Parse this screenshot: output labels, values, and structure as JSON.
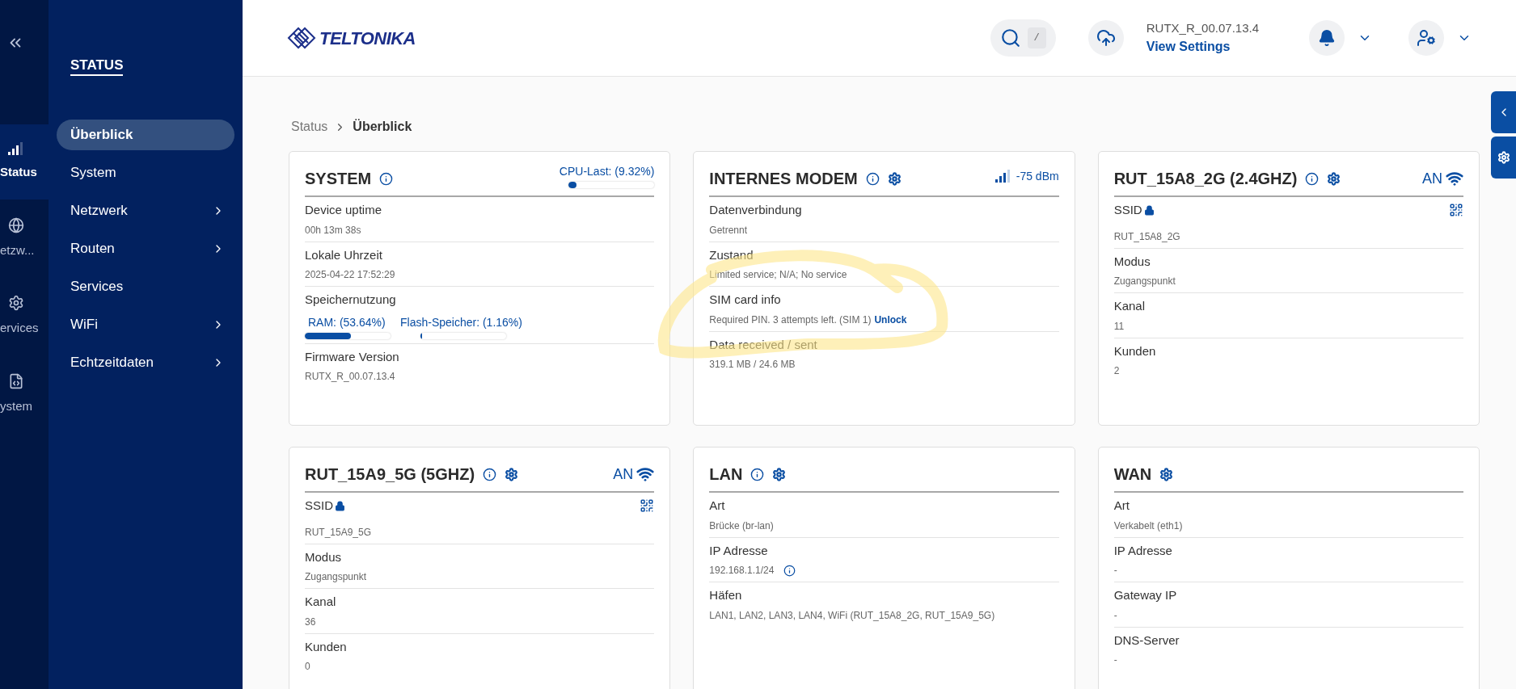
{
  "rail": [
    {
      "label": "Status",
      "kind": "signal",
      "selected": true
    },
    {
      "label": "etzw...",
      "kind": "globe",
      "selected": false
    },
    {
      "label": "ervices",
      "kind": "gear",
      "selected": false
    },
    {
      "label": "ystem",
      "kind": "file",
      "selected": false
    }
  ],
  "sidebar": {
    "title": "STATUS",
    "items": [
      {
        "label": "Überblick",
        "selected": true,
        "submenu": false
      },
      {
        "label": "System",
        "selected": false,
        "submenu": false
      },
      {
        "label": "Netzwerk",
        "selected": false,
        "submenu": true
      },
      {
        "label": "Routen",
        "selected": false,
        "submenu": true
      },
      {
        "label": "Services",
        "selected": false,
        "submenu": false
      },
      {
        "label": "WiFi",
        "selected": false,
        "submenu": true
      },
      {
        "label": "Echtzeitdaten",
        "selected": false,
        "submenu": true
      }
    ]
  },
  "header": {
    "logo": "TELTONIKA",
    "search_shortcut": "/",
    "firmware": "RUTX_R_00.07.13.4",
    "view_settings": "View Settings"
  },
  "breadcrumb": [
    "Status",
    "Überblick"
  ],
  "cards": [
    {
      "title": "SYSTEM",
      "info": true,
      "settings": false,
      "right": {
        "kind": "meter",
        "label": "CPU-Last: (9.32%)",
        "level": 0.0932
      },
      "rows": [
        {
          "kind": "text",
          "label": "Device uptime",
          "value": "00h 13m 38s"
        },
        {
          "kind": "text",
          "label": "Lokale Uhrzeit",
          "value": "2025-04-22 17:52:29"
        },
        {
          "kind": "meters",
          "label": "Speichernutzung",
          "meters": [
            {
              "label": "RAM: (53.64%)",
              "level": 0.5364
            },
            {
              "label": "Flash-Speicher: (1.16%)",
              "level": 0.0116
            }
          ]
        },
        {
          "kind": "text",
          "label": "Firmware Version",
          "value": "RUTX_R_00.07.13.4"
        }
      ]
    },
    {
      "title": "INTERNES MODEM",
      "info": true,
      "settings": true,
      "right": {
        "kind": "signal",
        "label": "-75 dBm"
      },
      "rows": [
        {
          "kind": "text",
          "label": "Datenverbindung",
          "value": "Getrennt"
        },
        {
          "kind": "text",
          "label": "Zustand",
          "value": "Limited service; N/A; No service"
        },
        {
          "kind": "link",
          "label": "SIM card info",
          "value": "Required PIN. 3 attempts left. (SIM 1)",
          "link": "Unlock"
        },
        {
          "kind": "text",
          "label": "Data received / sent",
          "value": "319.1 MB / 24.6 MB"
        }
      ]
    },
    {
      "title": "RUT_15A8_2G (2.4GHZ)",
      "info": true,
      "settings": true,
      "right": {
        "kind": "wifi",
        "label": "AN"
      },
      "rows": [
        {
          "kind": "ssid",
          "label": "SSID",
          "value": "RUT_15A8_2G"
        },
        {
          "kind": "text",
          "label": "Modus",
          "value": "Zugangspunkt"
        },
        {
          "kind": "text",
          "label": "Kanal",
          "value": "11"
        },
        {
          "kind": "text",
          "label": "Kunden",
          "value": "2"
        }
      ]
    },
    {
      "title": "RUT_15A9_5G (5GHZ)",
      "info": true,
      "settings": true,
      "right": {
        "kind": "wifi",
        "label": "AN"
      },
      "rows": [
        {
          "kind": "ssid",
          "label": "SSID",
          "value": "RUT_15A9_5G"
        },
        {
          "kind": "text",
          "label": "Modus",
          "value": "Zugangspunkt"
        },
        {
          "kind": "text",
          "label": "Kanal",
          "value": "36"
        },
        {
          "kind": "text",
          "label": "Kunden",
          "value": "0"
        }
      ]
    },
    {
      "title": "LAN",
      "info": true,
      "settings": true,
      "rows": [
        {
          "kind": "text",
          "label": "Art",
          "value": "Brücke (br-lan)"
        },
        {
          "kind": "info",
          "label": "IP Adresse",
          "value": "192.168.1.1/24"
        },
        {
          "kind": "text",
          "label": "Häfen",
          "value": "LAN1, LAN2, LAN3, LAN4, WiFi (RUT_15A8_2G, RUT_15A9_5G)"
        }
      ]
    },
    {
      "title": "WAN",
      "info": false,
      "settings": true,
      "rows": [
        {
          "kind": "text",
          "label": "Art",
          "value": "Verkabelt (eth1)"
        },
        {
          "kind": "text",
          "label": "IP Adresse",
          "value": "-"
        },
        {
          "kind": "text",
          "label": "Gateway IP",
          "value": "-"
        },
        {
          "kind": "text",
          "label": "DNS-Server",
          "value": "-"
        }
      ]
    }
  ]
}
